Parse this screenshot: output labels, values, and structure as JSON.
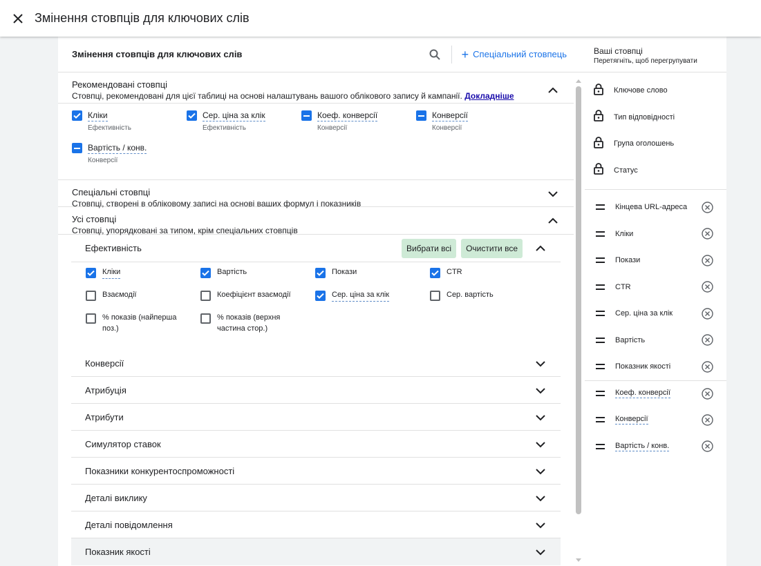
{
  "topbar": {
    "title": "Змінення стовпців для ключових слів"
  },
  "card": {
    "title": "Змінення стовпців для ключових слів",
    "special_column_label": "Спеціальний стовпець"
  },
  "recommended": {
    "title": "Рекомендовані стовпці",
    "description": "Стовпці, рекомендовані для цієї таблиці на основі налаштувань вашого облікового запису й кампанії.",
    "link": "Докладніше",
    "items": [
      {
        "label": "Кліки",
        "category": "Ефективність",
        "state": "checked"
      },
      {
        "label": "Сер. ціна за клік",
        "category": "Ефективність",
        "state": "checked"
      },
      {
        "label": "Коеф. конверсії",
        "category": "Конверсії",
        "state": "indeterminate"
      },
      {
        "label": "Конверсії",
        "category": "Конверсії",
        "state": "indeterminate"
      },
      {
        "label": "Вартість / конв.",
        "category": "Конверсії",
        "state": "indeterminate"
      }
    ]
  },
  "custom": {
    "title": "Спеціальні стовпці",
    "description": "Стовпці, створені в обліковому записі на основі ваших формул і показників"
  },
  "all_columns": {
    "title": "Усі стовпці",
    "description": "Стовпці, упорядковані за типом, крім спеціальних стовпців",
    "performance": {
      "title": "Ефективність",
      "select_all": "Вибрати всі",
      "clear_all": "Очистити все",
      "items": [
        {
          "label": "Кліки",
          "checked": true
        },
        {
          "label": "Вартість",
          "checked": true
        },
        {
          "label": "Покази",
          "checked": true
        },
        {
          "label": "CTR",
          "checked": true
        },
        {
          "label": "Взаємодії",
          "checked": false
        },
        {
          "label": "Коефіцієнт взаємодії",
          "checked": false
        },
        {
          "label": "Сер. ціна за клік",
          "checked": true
        },
        {
          "label": "Сер. вартість",
          "checked": false
        },
        {
          "label": "% показів (найперша поз.)",
          "checked": false
        },
        {
          "label": "% показів (верхня частина стор.)",
          "checked": false
        }
      ]
    },
    "categories": [
      "Конверсії",
      "Атрибуція",
      "Атрибути",
      "Симулятор ставок",
      "Показники конкурентоспроможності",
      "Деталі виклику",
      "Деталі повідомлення",
      "Показник якості"
    ]
  },
  "your_columns": {
    "title": "Ваші стовпці",
    "subtitle": "Перетягніть, щоб перегрупувати",
    "locked": [
      "Ключове слово",
      "Тип відповідності",
      "Група оголошень",
      "Статус"
    ],
    "items": [
      "Кінцева URL-адреса",
      "Кліки",
      "Покази",
      "CTR",
      "Сер. ціна за клік",
      "Вартість",
      "Показник якості"
    ],
    "conversion_items": [
      "Коеф. конверсії",
      "Конверсії",
      "Вартість / конв."
    ]
  },
  "colors": {
    "accent": "#1a73e8",
    "pill": "#ceead6",
    "link": "#1a0dab"
  }
}
